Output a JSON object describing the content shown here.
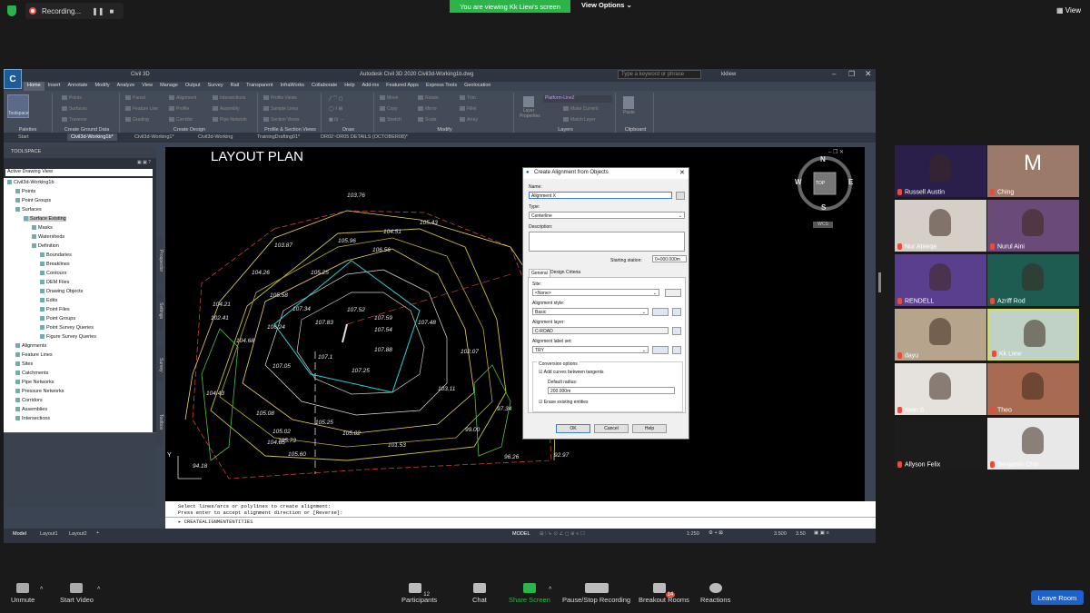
{
  "zoom_top": {
    "recording_label": "Recording...",
    "viewing_banner": "You are viewing Kk Liew's screen",
    "view_options": "View Options",
    "view_label": "View"
  },
  "civil3d": {
    "window_title": "Autodesk Civil 3D 2020   Civil3d-Working1b.dwg",
    "workspace": "Civil 3D",
    "search_placeholder": "Type a keyword or phrase",
    "user": "kkliew",
    "menu_tabs": [
      "Home",
      "Insert",
      "Annotate",
      "Modify",
      "Analyze",
      "View",
      "Manage",
      "Output",
      "Survey",
      "Rail",
      "Transparent",
      "InfraWorks",
      "Collaborate",
      "Help",
      "Add-ins",
      "Featured Apps",
      "Express Tools",
      "Geolocation"
    ],
    "ribbon_groups": [
      "Palettes",
      "Create Ground Data",
      "Create Design",
      "Profile & Section Views",
      "Draw",
      "Modify",
      "Layers",
      "Clipboard"
    ],
    "ribbon_buttons": {
      "toolspace": "Toolspace",
      "points": "Points",
      "surfaces": "Surfaces",
      "traverse": "Traverse",
      "parcel": "Parcel",
      "feature_line": "Feature Line",
      "grading": "Grading",
      "alignment": "Alignment",
      "profile": "Profile",
      "corridor": "Corridor",
      "intersections": "Intersections",
      "assembly": "Assembly",
      "pipe_network": "Pipe Network",
      "profile_views": "Profile Views",
      "sample_lines": "Sample Lines",
      "section_views": "Section Views",
      "move": "Move",
      "copy": "Copy",
      "stretch": "Stretch",
      "rotate": "Rotate",
      "mirror": "Mirror",
      "scale": "Scale",
      "trim": "Trim",
      "fillet": "Fillet",
      "array": "Array",
      "layer_properties": "Layer Properties",
      "layer_name": "Platform-Line2",
      "make_current": "Make Current",
      "match_layer": "Match Layer",
      "paste": "Paste"
    },
    "doc_tabs": [
      "Start",
      "Civil3d-Working1b*",
      "Civil3d-Working1*",
      "Civil3d-Working",
      "TrainingDrafting01*",
      "DR02~DR05 DETAILS (OCTOBER08)*"
    ],
    "toolspace": {
      "title": "TOOLSPACE",
      "view": "Active Drawing View",
      "tree": [
        {
          "label": "Civil3d-Working1b",
          "level": 0
        },
        {
          "label": "Points",
          "level": 1
        },
        {
          "label": "Point Groups",
          "level": 1
        },
        {
          "label": "Surfaces",
          "level": 1
        },
        {
          "label": "Surface Existing",
          "level": 2,
          "selected": true
        },
        {
          "label": "Masks",
          "level": 3
        },
        {
          "label": "Watersheds",
          "level": 3
        },
        {
          "label": "Definition",
          "level": 3
        },
        {
          "label": "Boundaries",
          "level": 4
        },
        {
          "label": "Breaklines",
          "level": 4
        },
        {
          "label": "Contours",
          "level": 4
        },
        {
          "label": "DEM Files",
          "level": 4
        },
        {
          "label": "Drawing Objects",
          "level": 4
        },
        {
          "label": "Edits",
          "level": 4
        },
        {
          "label": "Point Files",
          "level": 4
        },
        {
          "label": "Point Groups",
          "level": 4
        },
        {
          "label": "Point Survey Queries",
          "level": 4
        },
        {
          "label": "Figure Survey Queries",
          "level": 4
        },
        {
          "label": "Alignments",
          "level": 1
        },
        {
          "label": "Feature Lines",
          "level": 1
        },
        {
          "label": "Sites",
          "level": 1
        },
        {
          "label": "Catchments",
          "level": 1
        },
        {
          "label": "Pipe Networks",
          "level": 1
        },
        {
          "label": "Pressure Networks",
          "level": 1
        },
        {
          "label": "Corridors",
          "level": 1
        },
        {
          "label": "Assemblies",
          "level": 1
        },
        {
          "label": "Intersections",
          "level": 1
        }
      ],
      "side_tabs": [
        "Prospector",
        "Settings",
        "Survey",
        "Toolbox"
      ]
    },
    "drawing": {
      "title": "LAYOUT PLAN",
      "labels": [
        "103.76",
        "105.43",
        "104.51",
        "105.96",
        "106.56",
        "103.87",
        "104.26",
        "105.25",
        "104.21",
        "105.58",
        "107.34",
        "107.83",
        "107.59",
        "107.54",
        "107.52",
        "107.48",
        "104.68",
        "106.24",
        "107.88",
        "107.1",
        "107.25",
        "107.05",
        "104.43",
        "105.08",
        "105.02",
        "105.73",
        "105.25",
        "104.85",
        "105.02",
        "105.60",
        "101.53",
        "103.11",
        "102.41",
        "97.34",
        "99.00",
        "102.07",
        "96.26",
        "92.97",
        "94.18"
      ],
      "compass": {
        "n": "N",
        "s": "S",
        "e": "E",
        "w": "W",
        "top": "TOP",
        "wcs": "WCS"
      },
      "y_axis": "Y"
    },
    "dialog": {
      "title": "Create Alignment from Objects",
      "name_label": "Name:",
      "name_value": "Alignment X",
      "type_label": "Type:",
      "type_value": "Centerline",
      "description_label": "Description:",
      "starting_station_label": "Starting station:",
      "starting_station_value": "0+000.000m",
      "tab_general": "General",
      "tab_design": "Design Criteria",
      "site_label": "Site:",
      "site_value": "<None>",
      "style_label": "Alignment style:",
      "style_value": "Basic",
      "layer_label": "Alignment layer:",
      "layer_value": "C-ROAD",
      "labelset_label": "Alignment label set:",
      "labelset_value": "TRY",
      "conversion_label": "Conversion options",
      "add_curves_label": "Add curves between tangents",
      "default_radius_label": "Default radius:",
      "default_radius_value": "200.000m",
      "erase_label": "Erase existing entities",
      "ok": "OK",
      "cancel": "Cancel",
      "help": "Help"
    },
    "command_line": {
      "line1": "Select lines/arcs or polylines to create alignment:",
      "line2": "Press enter to accept alignment direction or [Reverse]:",
      "input": "CREATEALIGNMENTENTITIES"
    },
    "status": {
      "tabs": [
        "Model",
        "Layout1",
        "Layout2"
      ],
      "model_label": "MODEL",
      "scale": "1:250",
      "value1": "3.500",
      "value2": "3.50"
    }
  },
  "participants": [
    {
      "name": "Russell Austin",
      "muted": true,
      "bg": "#2a1f4a"
    },
    {
      "name": "Ching",
      "muted": true,
      "bg": "#9c7a6a",
      "initial": "M"
    },
    {
      "name": "Nur Ateeqa",
      "muted": true,
      "bg": "#d6cfc8"
    },
    {
      "name": "Nurul Aini",
      "muted": true,
      "bg": "#6a4a78"
    },
    {
      "name": "RENDELL",
      "muted": true,
      "bg": "#5b3f8f"
    },
    {
      "name": "Azriff Rod",
      "muted": true,
      "bg": "#1e5c52"
    },
    {
      "name": "dayu",
      "muted": true,
      "bg": "#b6a58c"
    },
    {
      "name": "Kk Liew",
      "muted": true,
      "bg": "#bfd2c5",
      "active": true
    },
    {
      "name": "Iwan S.",
      "muted": true,
      "bg": "#e5e2dd"
    },
    {
      "name": "Theo",
      "muted": true,
      "bg": "#a86a50"
    },
    {
      "name": "Allyson Felix",
      "muted": true,
      "bg": "#1c1c1c"
    },
    {
      "name": "Benjamin Chin",
      "muted": true,
      "bg": "#e8e8e8"
    }
  ],
  "zoom_bottom": {
    "unmute": "Unmute",
    "start_video": "Start Video",
    "participants": "Participants",
    "participants_count": "12",
    "chat": "Chat",
    "share_screen": "Share Screen",
    "recording": "Pause/Stop Recording",
    "breakout": "Breakout Rooms",
    "breakout_count": "14",
    "reactions": "Reactions",
    "leave": "Leave Room"
  }
}
